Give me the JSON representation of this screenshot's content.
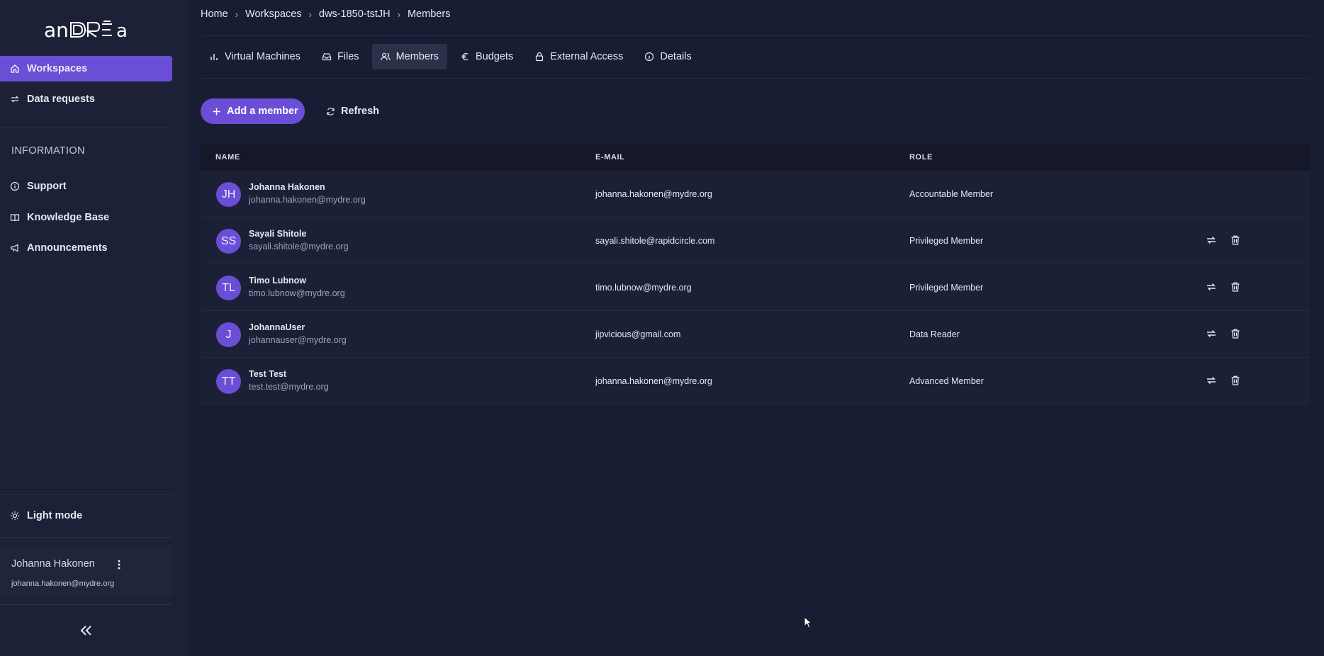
{
  "sidebar": {
    "logo_text": "anDRÉa",
    "nav": [
      {
        "label": "Workspaces",
        "icon": "home-icon",
        "active": true
      },
      {
        "label": "Data requests",
        "icon": "swap-arrows-icon",
        "active": false
      }
    ],
    "section_label": "INFORMATION",
    "info_links": [
      {
        "label": "Support",
        "icon": "info-circle-icon"
      },
      {
        "label": "Knowledge Base",
        "icon": "book-icon"
      },
      {
        "label": "Announcements",
        "icon": "megaphone-icon"
      }
    ],
    "theme_toggle": "Light mode",
    "user": {
      "name": "Johanna Hakonen",
      "email": "johanna.hakonen@mydre.org"
    }
  },
  "breadcrumb": [
    "Home",
    "Workspaces",
    "dws-1850-tstJH",
    "Members"
  ],
  "tabs": [
    {
      "label": "Virtual Machines",
      "icon": "bar-chart-icon",
      "active": false
    },
    {
      "label": "Files",
      "icon": "inbox-icon",
      "active": false
    },
    {
      "label": "Members",
      "icon": "users-icon",
      "active": true
    },
    {
      "label": "Budgets",
      "icon": "euro-icon",
      "active": false
    },
    {
      "label": "External Access",
      "icon": "lock-icon",
      "active": false
    },
    {
      "label": "Details",
      "icon": "info-circle-icon",
      "active": false
    }
  ],
  "actions": {
    "add_member": "Add a member",
    "refresh": "Refresh"
  },
  "table": {
    "columns": [
      "NAME",
      "E-MAIL",
      "ROLE"
    ],
    "rows": [
      {
        "initials": "JH",
        "name": "Johanna Hakonen",
        "sub": "johanna.hakonen@mydre.org",
        "email": "johanna.hakonen@mydre.org",
        "role": "Accountable Member",
        "actions": false
      },
      {
        "initials": "SS",
        "name": "Sayali Shitole",
        "sub": "sayali.shitole@mydre.org",
        "email": "sayali.shitole@rapidcircle.com",
        "role": "Privileged Member",
        "actions": true
      },
      {
        "initials": "TL",
        "name": "Timo Lubnow",
        "sub": "timo.lubnow@mydre.org",
        "email": "timo.lubnow@mydre.org",
        "role": "Privileged Member",
        "actions": true
      },
      {
        "initials": "J",
        "name": "JohannaUser",
        "sub": "johannauser@mydre.org",
        "email": "jipvicious@gmail.com",
        "role": "Data Reader",
        "actions": true
      },
      {
        "initials": "TT",
        "name": "Test Test",
        "sub": "test.test@mydre.org",
        "email": "johanna.hakonen@mydre.org",
        "role": "Advanced Member",
        "actions": true
      }
    ]
  },
  "colors": {
    "accent": "#6b4ed6",
    "background": "#181d33",
    "sidebar": "#1c2137"
  }
}
